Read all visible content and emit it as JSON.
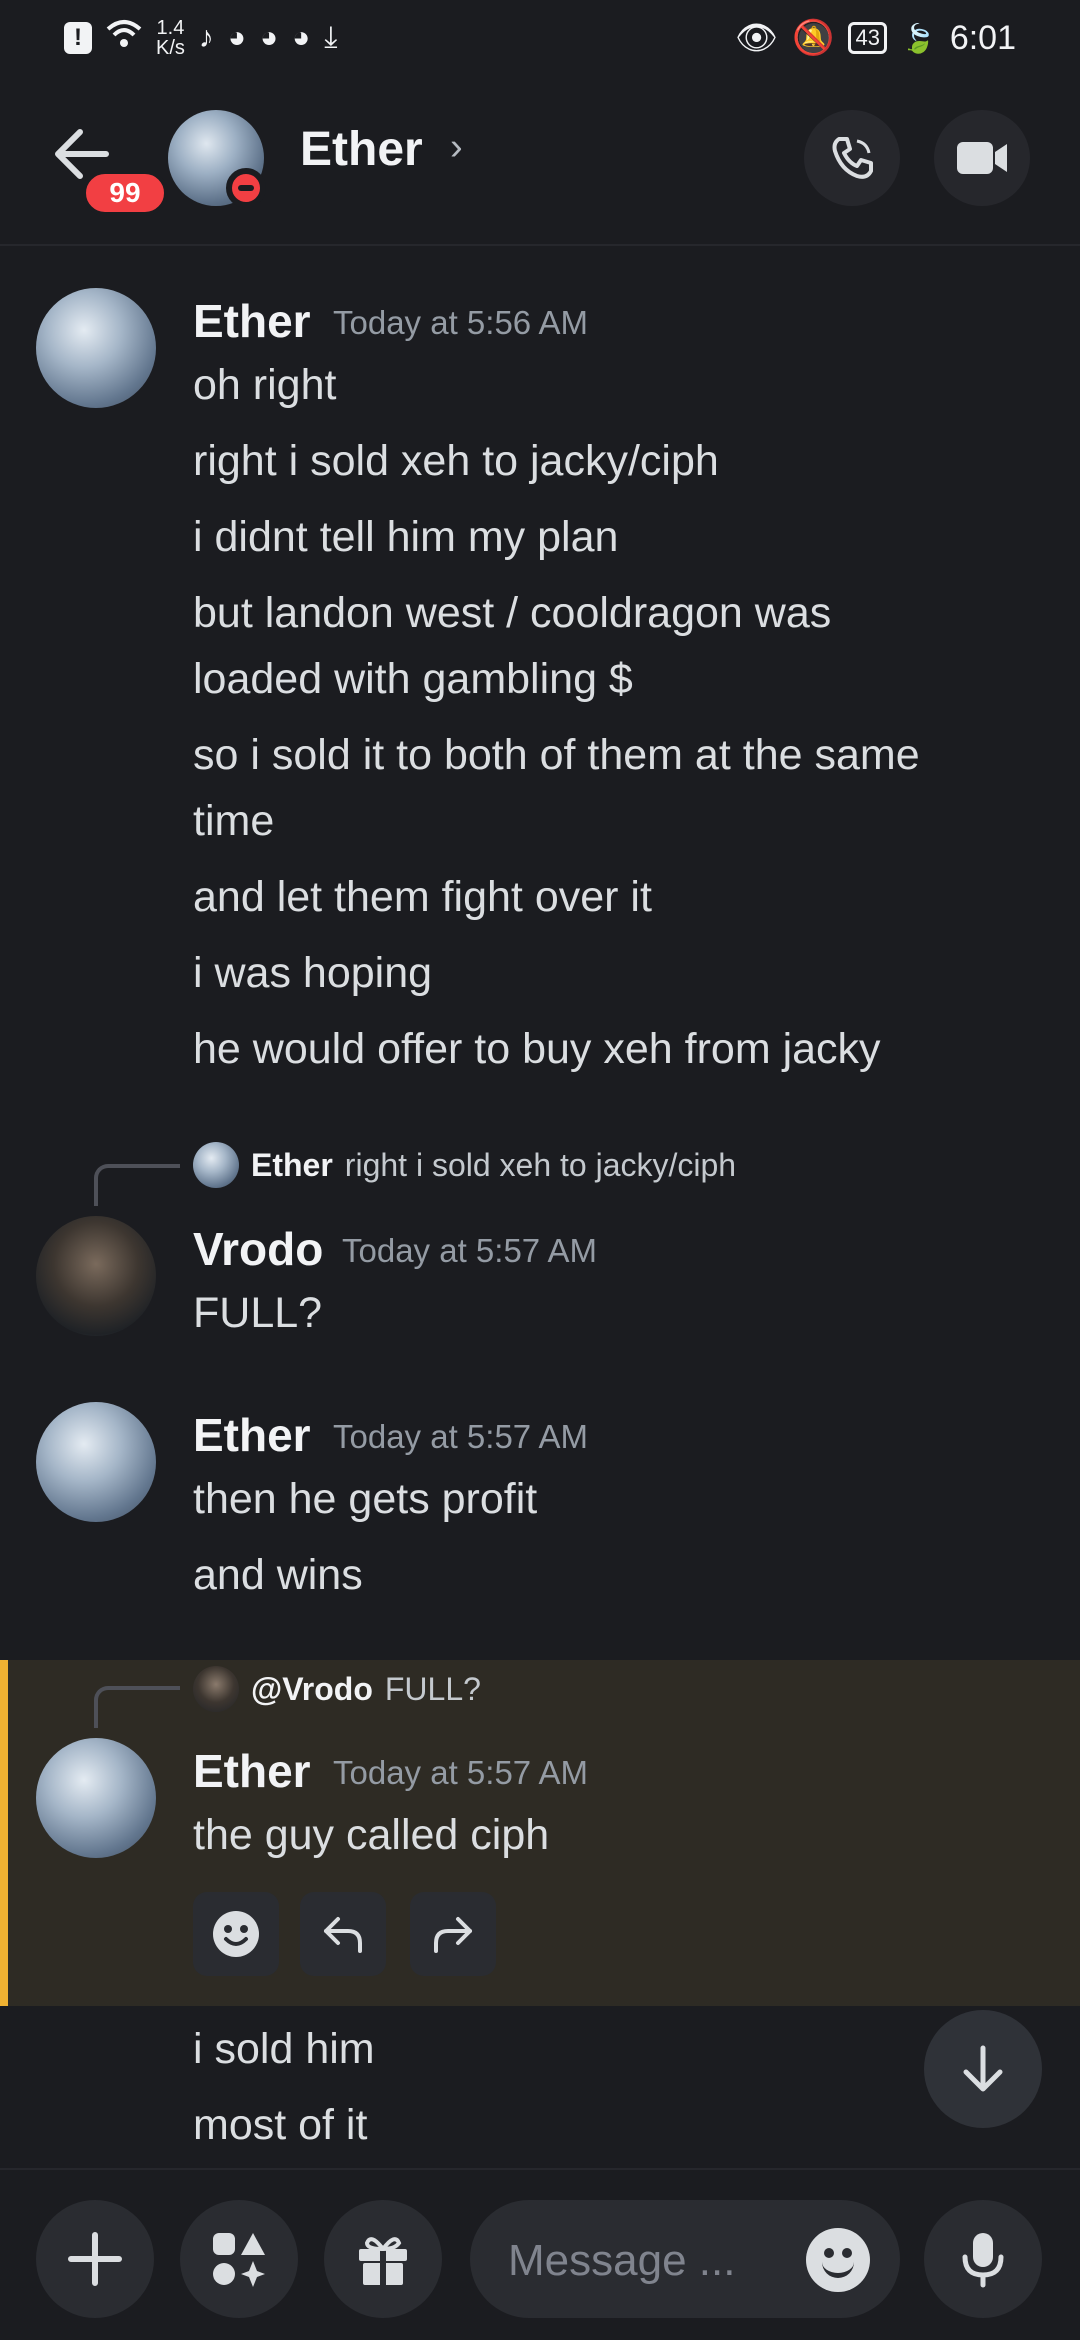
{
  "status_bar": {
    "net_speed_value": "1.4",
    "net_speed_unit": "K/s",
    "battery": "43",
    "time": "6:01"
  },
  "header": {
    "unread_count": "99",
    "title": "Ether",
    "chevron": "›",
    "icons": [
      "back-arrow-icon",
      "phone-icon",
      "video-camera-icon"
    ]
  },
  "messages": [
    {
      "author": "Ether",
      "time": "Today at 5:56 AM",
      "lines": [
        "oh right",
        "right i sold xeh to jacky/ciph",
        "i didnt tell him my plan",
        "but landon west / cooldragon was",
        "loaded with gambling $",
        "so i sold it to both of them at the same",
        "time",
        "and let them fight over it",
        "i was hoping",
        "he would offer to buy xeh from jacky"
      ]
    },
    {
      "reply_to": {
        "name": "Ether",
        "text": "right i sold xeh to jacky/ciph"
      },
      "author": "Vrodo",
      "time": "Today at 5:57 AM",
      "lines": [
        "FULL?"
      ]
    },
    {
      "author": "Ether",
      "time": "Today at 5:57 AM",
      "lines": [
        "then he gets profit",
        "and wins"
      ]
    },
    {
      "reply_to": {
        "name": "@Vrodo",
        "text": "FULL?"
      },
      "author": "Ether",
      "time": "Today at 5:57 AM",
      "lines": [
        "the guy called ciph"
      ],
      "highlighted": true
    },
    {
      "lines": [
        "i sold him",
        "most of it"
      ]
    }
  ],
  "reaction_buttons": [
    "emoji-icon",
    "reply-icon",
    "forward-icon"
  ],
  "composer": {
    "placeholder": "Message ...",
    "buttons": [
      "plus-icon",
      "apps-icon",
      "gift-icon",
      "emoji-icon",
      "microphone-icon"
    ]
  },
  "colors": {
    "background": "#1b1c20",
    "highlight_bg": "#2e2b24",
    "highlight_bar": "#f0b232",
    "badge": "#f23f43"
  }
}
